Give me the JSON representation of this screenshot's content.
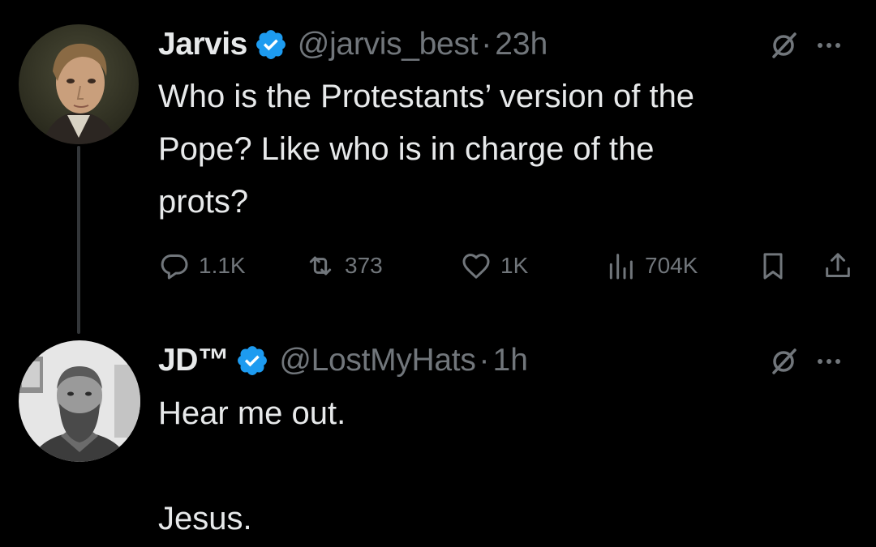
{
  "colors": {
    "background": "#000000",
    "primary_text": "#e7e9ea",
    "secondary_text": "#71767b",
    "verified_badge": "#1d9bf0",
    "thread_line": "#333639"
  },
  "tweets": [
    {
      "display_name": "Jarvis",
      "handle": "@jarvis_best",
      "separator": "·",
      "time": "23h",
      "text": "Who is the Protestants’ version of the\nPope? Like who is in charge of the\nprots?",
      "stats": {
        "replies": "1.1K",
        "retweets": "373",
        "likes": "1K",
        "views": "704K"
      },
      "icons": [
        "verified-badge-icon",
        "grok-icon",
        "more-icon",
        "reply-icon",
        "retweet-icon",
        "like-icon",
        "views-icon",
        "bookmark-icon",
        "share-icon"
      ]
    },
    {
      "display_name": "JD™",
      "handle": "@LostMyHats",
      "separator": "·",
      "time": "1h",
      "text": "Hear me out.\n\nJesus.",
      "icons": [
        "verified-badge-icon",
        "grok-icon",
        "more-icon"
      ]
    }
  ]
}
